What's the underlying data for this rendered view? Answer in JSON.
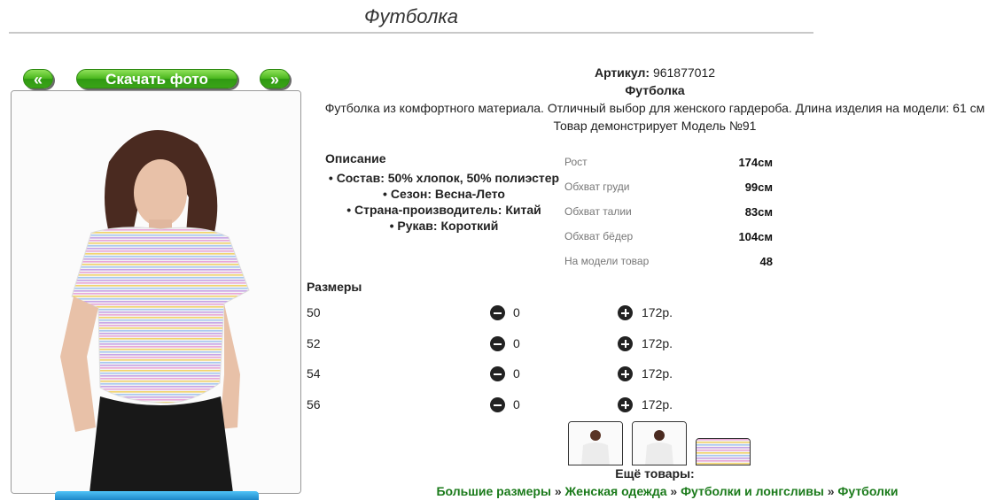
{
  "page": {
    "title": "Футболка"
  },
  "gallery": {
    "prev_label": "«",
    "download_label": "Скачать фото",
    "next_label": "»"
  },
  "product": {
    "article_label": "Артикул:",
    "article_value": "961877012",
    "name": "Футболка",
    "description": "Футболка из комфортного материала. Отличный выбор для женского гардероба. Длина изделия на модели: 61 см",
    "model_note": "Товар демонстрирует Модель №91"
  },
  "description_section": {
    "title": "Описание",
    "items": [
      "Состав: 50% хлопок, 50% полиэстер",
      "Сезон: Весна-Лето",
      "Страна-производитель: Китай",
      "Рукав: Короткий"
    ]
  },
  "model_params": [
    {
      "label": "Рост",
      "value": "174см"
    },
    {
      "label": "Обхват груди",
      "value": "99см"
    },
    {
      "label": "Обхват талии",
      "value": "83см"
    },
    {
      "label": "Обхват бёдер",
      "value": "104см"
    },
    {
      "label": "На модели товар",
      "value": "48"
    }
  ],
  "sizes": {
    "title": "Размеры",
    "rows": [
      {
        "size": "50",
        "qty": "0",
        "price": "172р."
      },
      {
        "size": "52",
        "qty": "0",
        "price": "172р."
      },
      {
        "size": "54",
        "qty": "0",
        "price": "172р."
      },
      {
        "size": "56",
        "qty": "0",
        "price": "172р."
      }
    ]
  },
  "more": {
    "title": "Ещё товары:",
    "breadcrumbs": [
      "Большие размеры",
      "Женская одежда",
      "Футболки и лонгсливы",
      "Футболки"
    ],
    "separator": "»"
  },
  "colors": {
    "accent_green": "#3aa318",
    "link_green": "#1a7a1a",
    "button_dark": "#222222"
  },
  "icons": {
    "minus": "minus-circle-icon",
    "plus": "plus-circle-icon"
  }
}
